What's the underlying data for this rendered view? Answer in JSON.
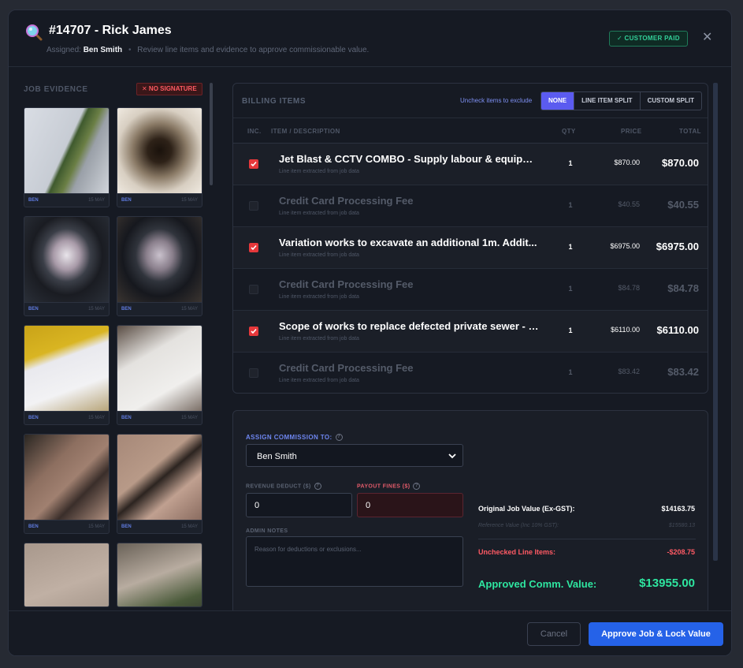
{
  "header": {
    "title": "#14707 - Rick James",
    "assigned_label": "Assigned:",
    "assigned_name": "Ben Smith",
    "separator": "•",
    "subtitle": "Review line items and evidence to approve commissionable value.",
    "status_badge": "✓ CUSTOMER PAID",
    "close_glyph": "✕",
    "icon": "magnifier-icon"
  },
  "evidence": {
    "title": "JOB EVIDENCE",
    "signature_badge": "✕  NO SIGNATURE",
    "photos": [
      {
        "who": "BEN",
        "date": "15 MAY"
      },
      {
        "who": "BEN",
        "date": "15 MAY"
      },
      {
        "who": "BEN",
        "date": "15 MAY"
      },
      {
        "who": "BEN",
        "date": "15 MAY"
      },
      {
        "who": "BEN",
        "date": "15 MAY"
      },
      {
        "who": "BEN",
        "date": "15 MAY"
      },
      {
        "who": "BEN",
        "date": "15 MAY"
      },
      {
        "who": "BEN",
        "date": "15 MAY"
      },
      {
        "who": "",
        "date": ""
      },
      {
        "who": "",
        "date": ""
      }
    ]
  },
  "billing": {
    "title": "BILLING ITEMS",
    "hint": "Uncheck items to exclude",
    "split_options": [
      "NONE",
      "LINE ITEM SPLIT",
      "CUSTOM SPLIT"
    ],
    "selected_split": "NONE",
    "columns": {
      "inc": "INC.",
      "item": "ITEM / DESCRIPTION",
      "qty": "QTY",
      "price": "PRICE",
      "total": "TOTAL"
    },
    "rows": [
      {
        "checked": true,
        "name": "Jet Blast & CCTV COMBO - Supply labour & equipm...",
        "desc": "Line item extracted from job data",
        "qty": "1",
        "price": "$870.00",
        "total": "$870.00"
      },
      {
        "checked": false,
        "name": "Credit Card Processing Fee",
        "desc": "Line item extracted from job data",
        "qty": "1",
        "price": "$40.55",
        "total": "$40.55"
      },
      {
        "checked": true,
        "name": "Variation works to excavate an additional 1m. Addit...",
        "desc": "Line item extracted from job data",
        "qty": "1",
        "price": "$6975.00",
        "total": "$6975.00"
      },
      {
        "checked": false,
        "name": "Credit Card Processing Fee",
        "desc": "Line item extracted from job data",
        "qty": "1",
        "price": "$84.78",
        "total": "$84.78"
      },
      {
        "checked": true,
        "name": "Scope of works to replace defected private sewer - S...",
        "desc": "Line item extracted from job data",
        "qty": "1",
        "price": "$6110.00",
        "total": "$6110.00"
      },
      {
        "checked": false,
        "name": "Credit Card Processing Fee",
        "desc": "Line item extracted from job data",
        "qty": "1",
        "price": "$83.42",
        "total": "$83.42"
      }
    ]
  },
  "commission": {
    "assign_label": "ASSIGN COMMISSION TO:",
    "assignee": "Ben Smith",
    "revenue_deduct_label": "REVENUE DEDUCT ($)",
    "revenue_deduct_value": "0",
    "payout_fines_label": "PAYOUT FINES ($)",
    "payout_fines_value": "0",
    "admin_notes_label": "ADMIN NOTES",
    "admin_notes_placeholder": "Reason for deductions or exclusions...",
    "help_glyph": "?",
    "summary": {
      "original_label": "Original Job Value (Ex-GST):",
      "original_value": "$14163.75",
      "reference_label": "Reference Value (Inc 10% GST):",
      "reference_value": "$15580.13",
      "unchecked_label": "Unchecked Line Items:",
      "unchecked_value": "-$208.75",
      "approved_label": "Approved Comm. Value:",
      "approved_value": "$13955.00"
    }
  },
  "footer": {
    "cancel_label": "Cancel",
    "approve_label": "Approve Job & Lock Value"
  },
  "colors": {
    "accent": "#2562e8",
    "paid_green": "#33d19a",
    "danger": "#e5383b",
    "approved_green": "#2ee6a0"
  }
}
